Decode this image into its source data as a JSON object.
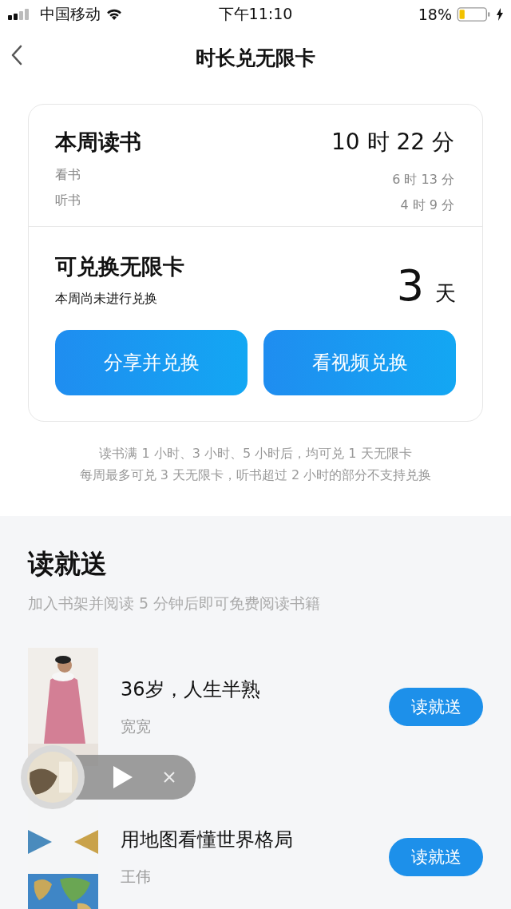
{
  "status_bar": {
    "carrier": "中国移动",
    "time": "下午11:10",
    "battery": "18%"
  },
  "nav": {
    "title": "时长兑无限卡"
  },
  "weekly": {
    "label": "本周读书",
    "total": "10 时 22 分",
    "rows": [
      {
        "label": "看书",
        "value": "6 时 13 分"
      },
      {
        "label": "听书",
        "value": "4 时 9 分"
      }
    ]
  },
  "exchange": {
    "label": "可兑换无限卡",
    "note": "本周尚未进行兑换",
    "days": "3",
    "unit": "天",
    "buttons": [
      "分享并兑换",
      "看视频兑换"
    ]
  },
  "rules": [
    "读书满 1 小时、3 小时、5 小时后，均可兑 1 天无限卡",
    "每周最多可兑 3 天无限卡，听书超过 2 小时的部分不支持兑换"
  ],
  "promo": {
    "title": "读就送",
    "subtitle": "加入书架并阅读 5 分钟后即可免费阅读书籍",
    "books": [
      {
        "title": "36岁，人生半熟",
        "author": "宽宽",
        "button": "读就送",
        "kind": "portrait"
      },
      {
        "title": "用地图看懂世界格局",
        "author": "王伟",
        "button": "读就送",
        "kind": "map"
      }
    ]
  },
  "player": {
    "playing": false
  }
}
